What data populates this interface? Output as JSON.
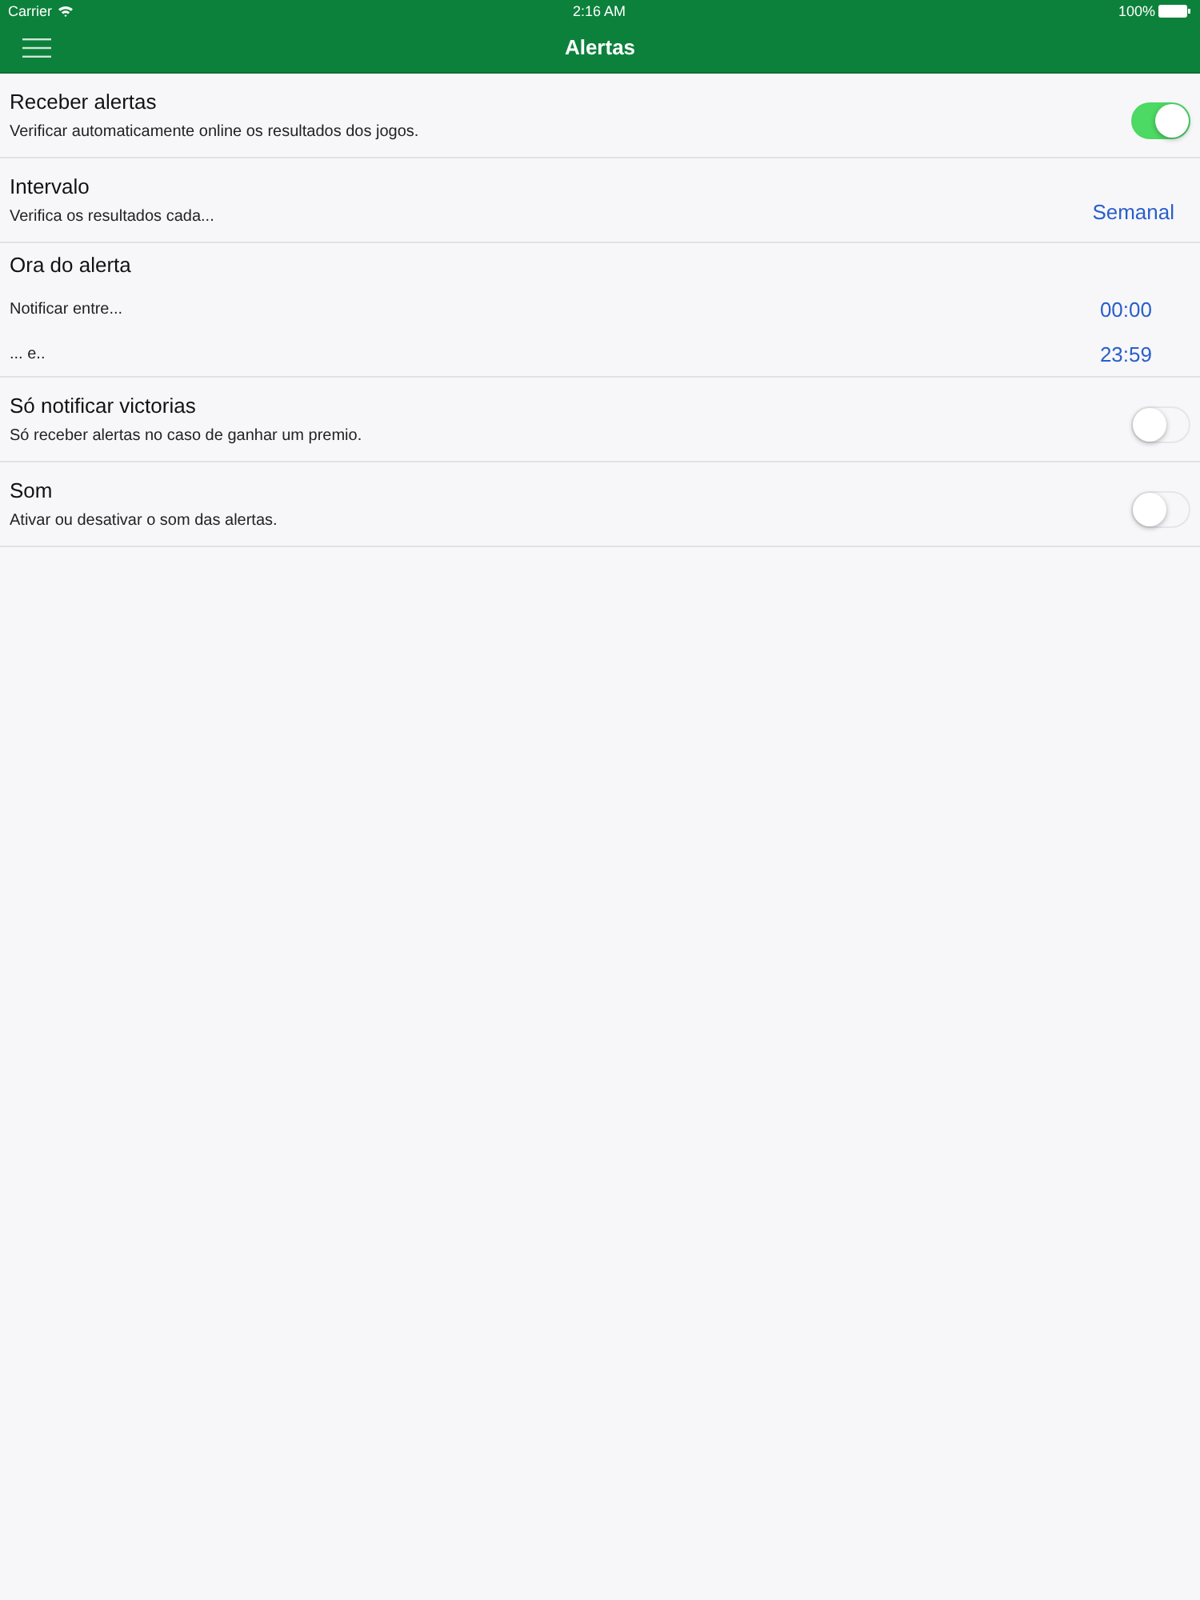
{
  "status_bar": {
    "carrier": "Carrier",
    "time": "2:16 AM",
    "battery": "100%"
  },
  "nav_bar": {
    "title": "Alertas"
  },
  "sections": [
    {
      "kind": "switch",
      "title": "Receber alertas",
      "subtitle": "Verificar automaticamente online os resultados dos jogos.",
      "on": true
    },
    {
      "kind": "value",
      "title": "Intervalo",
      "subtitle": "Verifica os resultados cada...",
      "value": "Semanal"
    },
    {
      "kind": "times",
      "title": "Ora do alerta",
      "lines": [
        {
          "label": "Notificar entre...",
          "value": "00:00"
        },
        {
          "label": "... e..",
          "value": "23:59"
        }
      ]
    },
    {
      "kind": "switch",
      "title": "Só notificar victorias",
      "subtitle": "Só receber alertas no caso de ganhar um premio.",
      "on": false
    },
    {
      "kind": "switch",
      "title": "Som",
      "subtitle": "Ativar ou desativar o som das alertas.",
      "on": false
    }
  ]
}
